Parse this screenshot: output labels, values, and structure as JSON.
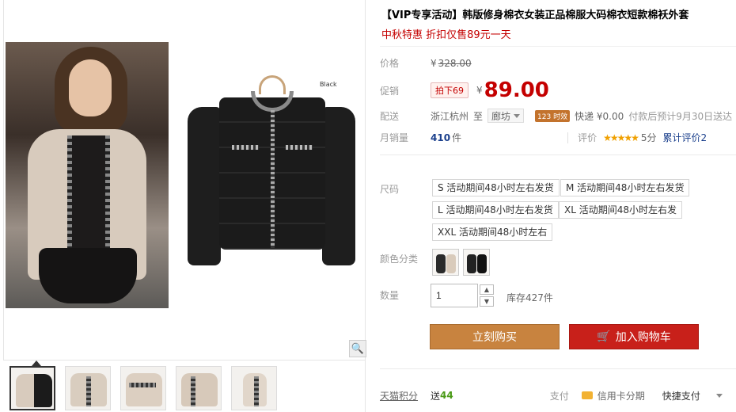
{
  "product": {
    "title": "【VIP专享活动】韩版修身棉衣女装正品棉服大码棉衣短款棉袄外套",
    "promo": "中秋特惠 折扣仅售89元一天",
    "image_label": "Black"
  },
  "price": {
    "label": "价格",
    "currency": "¥",
    "original": "328.00",
    "promo_label": "促销",
    "promo_tag": "拍下69",
    "current": "89.00"
  },
  "shipping": {
    "label": "配送",
    "from": "浙江杭州",
    "to_label": "至",
    "to": "廊坊",
    "timing_badge": "123 时效",
    "method": "快递 ¥0.00",
    "eta": "付款后预计9月30日送达"
  },
  "sales": {
    "label": "月销量",
    "count": "410",
    "unit": "件",
    "review_label": "评价",
    "stars": "★★★★★",
    "score": "5分",
    "review_link": "累计评价2"
  },
  "sizes": {
    "label": "尺码",
    "options": [
      "S 活动期间48小时左右发货",
      "M 活动期间48小时左右发货",
      "L 活动期间48小时左右发货",
      "XL 活动期间48小时左右发",
      "XXL 活动期间48小时左右"
    ]
  },
  "colors": {
    "label": "颜色分类"
  },
  "quantity": {
    "label": "数量",
    "value": "1",
    "stock": "库存427件",
    "up": "▲",
    "down": "▼"
  },
  "actions": {
    "buy": "立刻购买",
    "cart": "加入购物车",
    "cart_icon": "🛒"
  },
  "bottom": {
    "points_label": "天猫积分",
    "points_prefix": "送",
    "points_value": "44",
    "pay_label": "支付",
    "credit": "信用卡分期",
    "quick_pay": "快捷支付"
  },
  "icons": {
    "zoom": "🔍"
  }
}
